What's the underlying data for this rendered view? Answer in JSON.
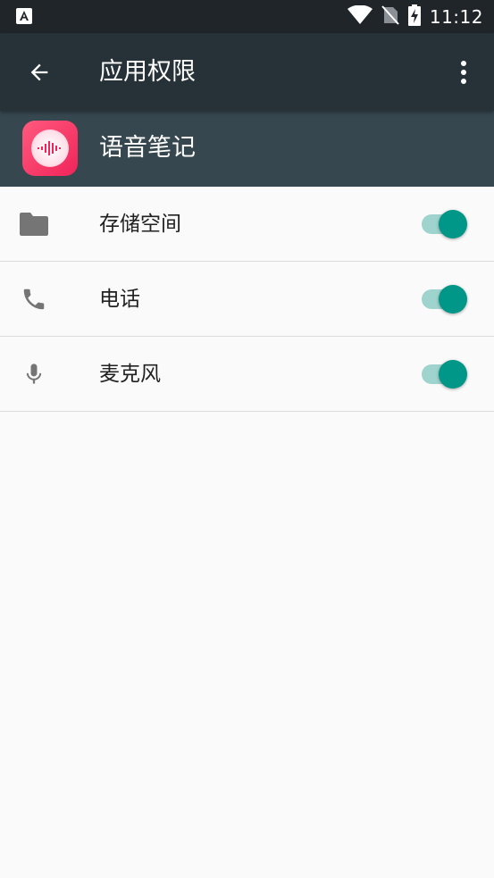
{
  "status_bar": {
    "time": "11:12",
    "icons": [
      "text-a-icon",
      "wifi-icon",
      "no-sim-icon",
      "battery-charging-icon"
    ]
  },
  "app_bar": {
    "title": "应用权限",
    "back_icon": "arrow-left-icon",
    "menu_icon": "more-vert-icon"
  },
  "app": {
    "name": "语音笔记",
    "icon": "voice-wave-icon"
  },
  "permissions": [
    {
      "label": "存储空间",
      "icon": "folder-icon",
      "enabled": true
    },
    {
      "label": "电话",
      "icon": "phone-icon",
      "enabled": true
    },
    {
      "label": "麦克风",
      "icon": "microphone-icon",
      "enabled": true
    }
  ],
  "colors": {
    "status_bar": "#1f2529",
    "app_bar": "#263238",
    "app_header": "#37474f",
    "switch_thumb": "#009688",
    "switch_track": "#9fd3cd",
    "icon_grey": "#757575",
    "app_icon": "#f0245a"
  }
}
